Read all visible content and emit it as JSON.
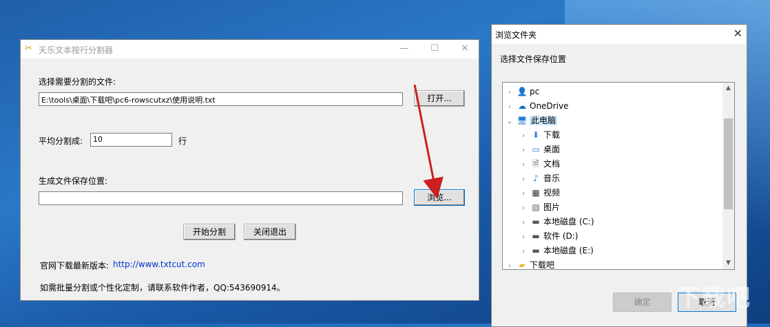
{
  "main_window": {
    "title": "天乐文本按行分割器",
    "app_icon": "scissors-icon",
    "file_label": "选择需要分割的文件:",
    "file_path": "E:\\tools\\桌面\\下载吧\\pc6-rowscutxz\\使用说明.txt",
    "open_button": "打开...",
    "split_label": "平均分割成:",
    "split_value": "10",
    "split_unit": "行",
    "save_label": "生成文件保存位置:",
    "save_path": "",
    "browse_button": "浏览...",
    "start_button": "开始分割",
    "close_button": "关闭退出",
    "website_label": "官网下载最新版本:",
    "website_link": "http://www.txtcut.com",
    "contact_text": "如需批量分割或个性化定制，请联系软件作者，QQ:543690914。"
  },
  "browse_dialog": {
    "title": "浏览文件夹",
    "description": "选择文件保存位置",
    "tree": [
      {
        "label": "pc",
        "icon": "user-icon",
        "level": 0,
        "expanded": false
      },
      {
        "label": "OneDrive",
        "icon": "cloud-icon",
        "level": 0,
        "expanded": false
      },
      {
        "label": "此电脑",
        "icon": "computer-icon",
        "level": 0,
        "expanded": true,
        "selected": true
      },
      {
        "label": "下载",
        "icon": "download-icon",
        "level": 1,
        "expanded": false
      },
      {
        "label": "桌面",
        "icon": "desktop-icon",
        "level": 1,
        "expanded": false
      },
      {
        "label": "文档",
        "icon": "document-icon",
        "level": 1,
        "expanded": false
      },
      {
        "label": "音乐",
        "icon": "music-icon",
        "level": 1,
        "expanded": false
      },
      {
        "label": "视频",
        "icon": "video-icon",
        "level": 1,
        "expanded": false
      },
      {
        "label": "图片",
        "icon": "picture-icon",
        "level": 1,
        "expanded": false
      },
      {
        "label": "本地磁盘 (C:)",
        "icon": "drive-icon",
        "level": 1,
        "expanded": false
      },
      {
        "label": "软件 (D:)",
        "icon": "drive-icon",
        "level": 1,
        "expanded": false
      },
      {
        "label": "本地磁盘 (E:)",
        "icon": "drive-icon",
        "level": 1,
        "expanded": false
      },
      {
        "label": "下载吧",
        "icon": "folder-icon",
        "level": 0,
        "expanded": false
      }
    ],
    "ok_button": "确定",
    "cancel_button": "取消"
  },
  "watermark": "下载吧",
  "colors": {
    "accent": "#0078d7",
    "selection": "#cce8ff",
    "arrow": "#cc1f1f",
    "link": "#0033cc"
  }
}
